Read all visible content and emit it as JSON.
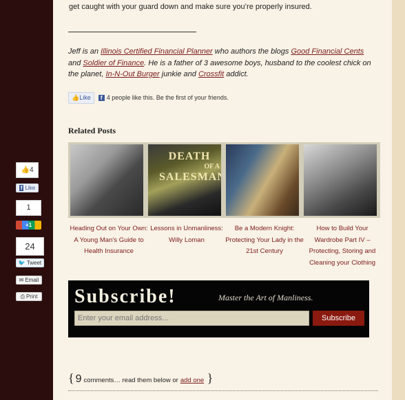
{
  "intro": "get caught with your guard down and make sure you’re properly insured.",
  "bio": {
    "p1": "Jeff is an ",
    "l1": "Illinois Certified Financial Planner",
    "p2": " who authors the blogs ",
    "l2": "Good Financial Cents",
    "p3": " and ",
    "l3": "Soldier of Finance",
    "p4": ". He is a father of 3 awesome boys, husband to the coolest chick on the planet, ",
    "l4": "In-N-Out Burger",
    "p5": " junkie and ",
    "l5": "Crossfit",
    "p6": " addict."
  },
  "fb_like": {
    "button": "Like",
    "text": "4 people like this. Be the first of your friends."
  },
  "related": {
    "title": "Related Posts",
    "posts": [
      {
        "title": "Heading Out on Your Own: A Young Man’s Guide to Health Insurance"
      },
      {
        "title": "Lessons in Unmanliness: Willy Loman"
      },
      {
        "title": "Be a Modern Knight: Protecting Your Lady in the 21st Century"
      },
      {
        "title": "How to Build Your Wardrobe Part IV – Protecting, Storing and Cleaning your Clothing"
      }
    ],
    "thumb2_text": {
      "line1": "DEATH",
      "line2": "OF A",
      "line3": "SALESMAN"
    }
  },
  "subscribe": {
    "title": "Subscribe!",
    "tagline": "Master the Art of Manliness.",
    "placeholder": "Enter your email address...",
    "button": "Subscribe"
  },
  "comments": {
    "count": "9",
    "text": "comments… read them below or",
    "link": "add one"
  },
  "social": {
    "fb_count": "4",
    "fb_label": "Like",
    "g_count": "1",
    "g_label": "+1",
    "tw_count": "24",
    "tw_label": "Tweet",
    "email_label": "Email",
    "print_label": "Print"
  },
  "colors": {
    "link": "#7a1c1c",
    "page_bg": "#f9f2e6",
    "sidebar_bg": "#2b0d0d",
    "subscribe_button": "#8a1a10"
  }
}
